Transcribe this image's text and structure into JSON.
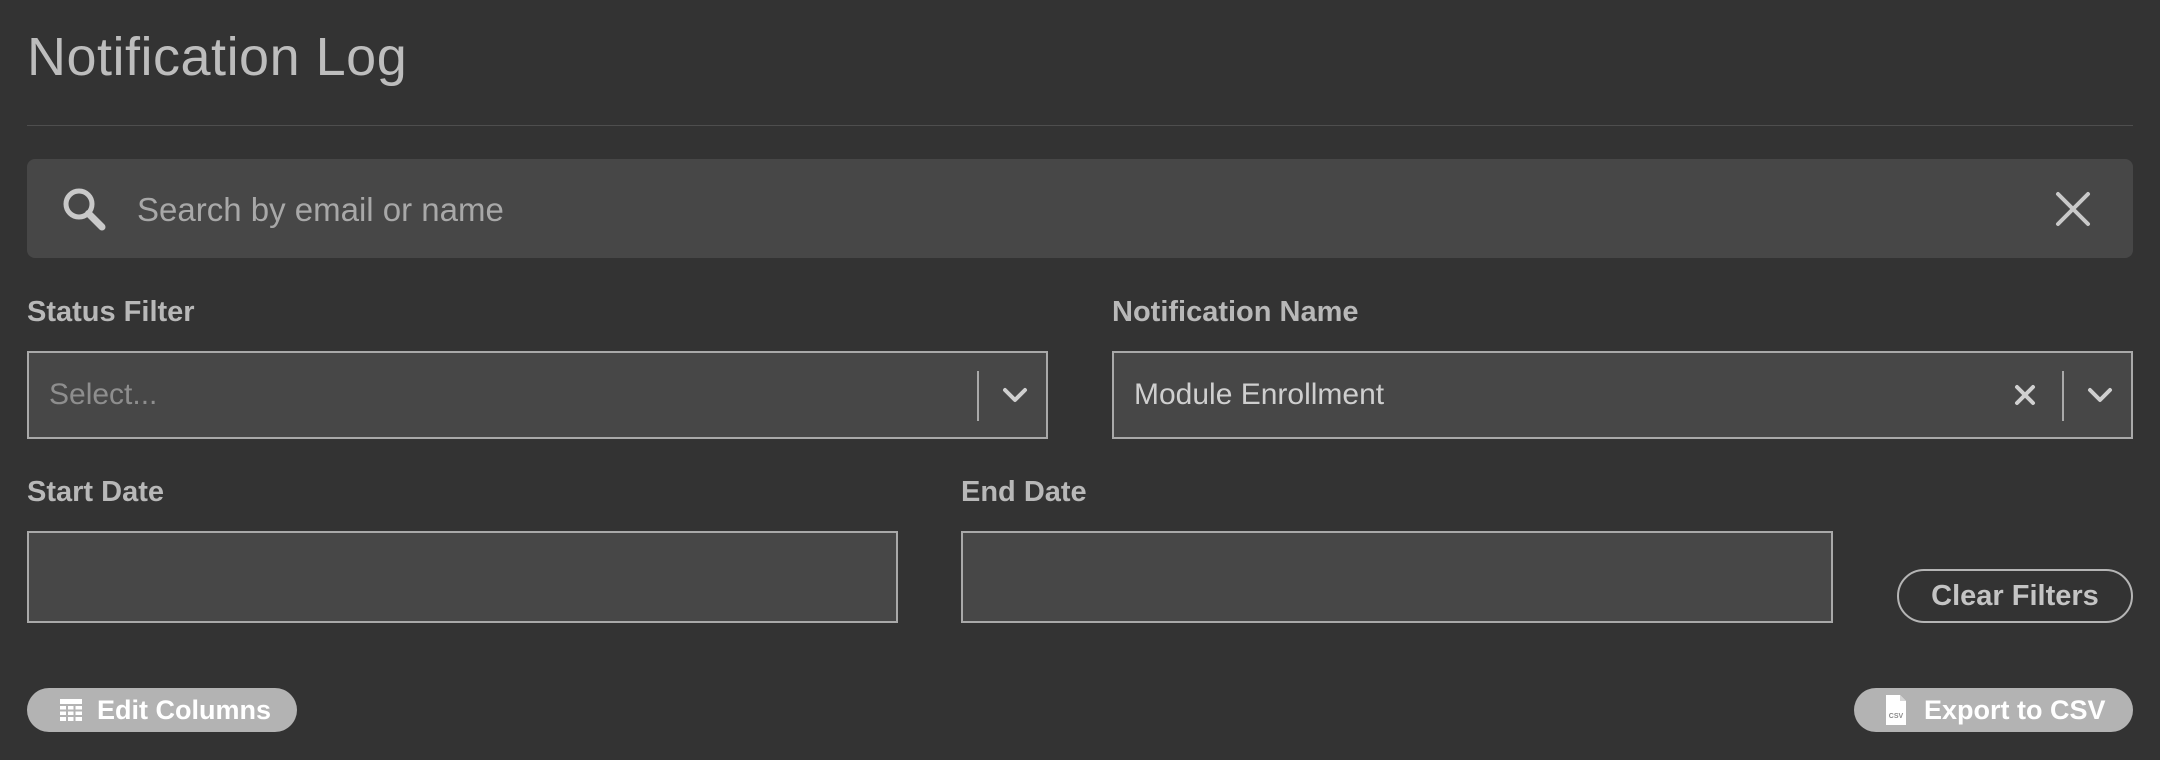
{
  "page": {
    "title": "Notification Log"
  },
  "search": {
    "placeholder": "Search by email or name",
    "value": ""
  },
  "filters": {
    "status": {
      "label": "Status Filter",
      "placeholder": "Select..."
    },
    "notification_name": {
      "label": "Notification Name",
      "value": "Module Enrollment"
    },
    "start_date": {
      "label": "Start Date",
      "value": ""
    },
    "end_date": {
      "label": "End Date",
      "value": ""
    },
    "clear_label": "Clear Filters"
  },
  "actions": {
    "edit_columns_label": "Edit Columns",
    "export_csv_label": "Export to CSV",
    "csv_icon_text": "CSV"
  },
  "icons": {
    "search": "search-icon",
    "clear": "close-icon",
    "dropdown": "chevron-down-icon",
    "table": "table-grid-icon",
    "file": "csv-file-icon"
  },
  "colors": {
    "background": "#333333",
    "field": "#474747",
    "border": "#a9a9a9",
    "pill": "#b3b3b3"
  }
}
